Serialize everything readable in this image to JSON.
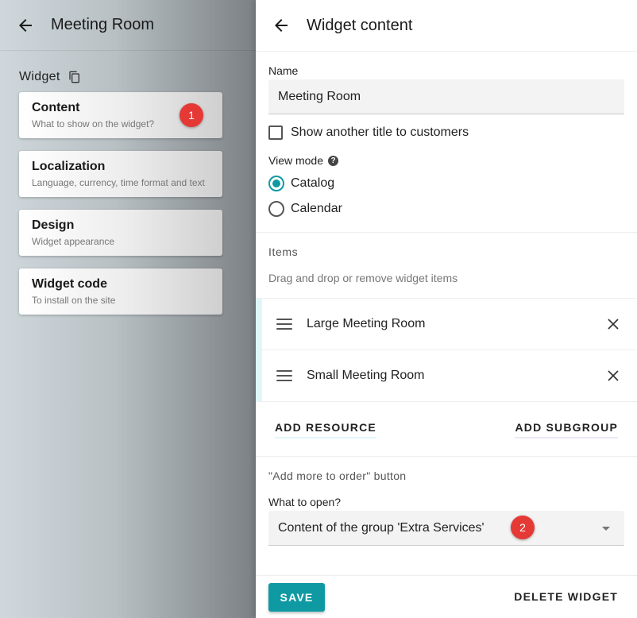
{
  "left_panel": {
    "title": "Meeting Room",
    "section_label": "Widget",
    "items": [
      {
        "title": "Content",
        "subtitle": "What to show on the widget?"
      },
      {
        "title": "Localization",
        "subtitle": "Language, currency, time format and text"
      },
      {
        "title": "Design",
        "subtitle": "Widget appearance"
      },
      {
        "title": "Widget code",
        "subtitle": "To install on the site"
      }
    ],
    "badge": "1"
  },
  "right_panel": {
    "title": "Widget content",
    "name_label": "Name",
    "name_value": "Meeting Room",
    "show_title_checkbox": "Show another title to customers",
    "view_mode_label": "View mode",
    "view_mode_help": "?",
    "view_mode_options": [
      {
        "label": "Catalog",
        "checked": true
      },
      {
        "label": "Calendar",
        "checked": false
      }
    ],
    "items_label": "Items",
    "items_hint": "Drag and drop or remove widget items",
    "items": [
      {
        "label": "Large Meeting Room"
      },
      {
        "label": "Small Meeting Room"
      }
    ],
    "add_resource": "ADD RESOURCE",
    "add_subgroup": "ADD SUBGROUP",
    "add_more_label": "\"Add more to order\" button",
    "what_to_open_label": "What to open?",
    "what_to_open_value": "Content of the group 'Extra Services'",
    "badge": "2",
    "save": "SAVE",
    "delete": "DELETE WIDGET"
  },
  "colors": {
    "accent": "#0f9aa3",
    "badge": "#e53935"
  }
}
